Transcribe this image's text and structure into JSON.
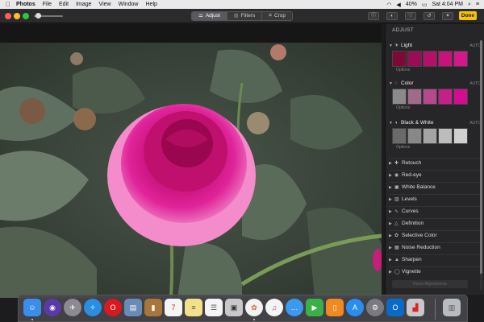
{
  "menubar": {
    "app": "Photos",
    "items": [
      "File",
      "Edit",
      "Image",
      "View",
      "Window",
      "Help"
    ],
    "battery": "40%",
    "datetime": "Sat 4:04 PM"
  },
  "toolbar": {
    "tabs": [
      {
        "label": "Adjust",
        "icon": "sliders-icon",
        "active": true
      },
      {
        "label": "Filters",
        "icon": "filters-icon",
        "active": false
      },
      {
        "label": "Crop",
        "icon": "crop-icon",
        "active": false
      }
    ],
    "done_label": "Done",
    "zoom_level": 0.05
  },
  "panel": {
    "title": "ADJUST",
    "sections": [
      {
        "label": "Light",
        "icon": "sun-icon",
        "auto": "AUTO",
        "options": "Options",
        "thumbs": [
          "#7a0a3a",
          "#9a0c55",
          "#b4106a",
          "#c8147a",
          "#d4188a"
        ]
      },
      {
        "label": "Color",
        "icon": "color-circle-icon",
        "auto": "AUTO",
        "options": "Options",
        "thumbs": [
          "#8a8a8a",
          "#a06a8a",
          "#b44a8c",
          "#c4208a",
          "#d40c8e"
        ]
      },
      {
        "label": "Black & White",
        "icon": "bw-circle-icon",
        "auto": "AUTO",
        "options": "Options",
        "thumbs": [
          "#6a6a6a",
          "#888888",
          "#a4a4a4",
          "#bcbcbc",
          "#d0d0d0"
        ]
      }
    ],
    "tools": [
      {
        "label": "Retouch",
        "icon": "bandage-icon"
      },
      {
        "label": "Red-eye",
        "icon": "eye-icon"
      },
      {
        "label": "White Balance",
        "icon": "white-balance-icon"
      },
      {
        "label": "Levels",
        "icon": "levels-icon"
      },
      {
        "label": "Curves",
        "icon": "curves-icon"
      },
      {
        "label": "Definition",
        "icon": "definition-icon"
      },
      {
        "label": "Selective Color",
        "icon": "selective-color-icon"
      },
      {
        "label": "Noise Reduction",
        "icon": "noise-icon"
      },
      {
        "label": "Sharpen",
        "icon": "sharpen-icon"
      },
      {
        "label": "Vignette",
        "icon": "vignette-icon"
      }
    ],
    "reset_label": "Reset Adjustments"
  },
  "colors": {
    "accent": "#f5c400",
    "rose": "#d4148a"
  },
  "dock": [
    "finder-icon",
    "siri-icon",
    "launchpad-icon",
    "safari-icon",
    "opera-icon",
    "preview-icon",
    "contacts-icon",
    "calendar-icon",
    "notes-icon",
    "reminders-icon",
    "photo-booth-icon",
    "photos-icon",
    "itunes-icon",
    "messages-icon",
    "facetime-icon",
    "ibooks-icon",
    "app-store-icon",
    "system-preferences-icon",
    "outlook-icon",
    "grab-icon",
    "trash-icon"
  ]
}
